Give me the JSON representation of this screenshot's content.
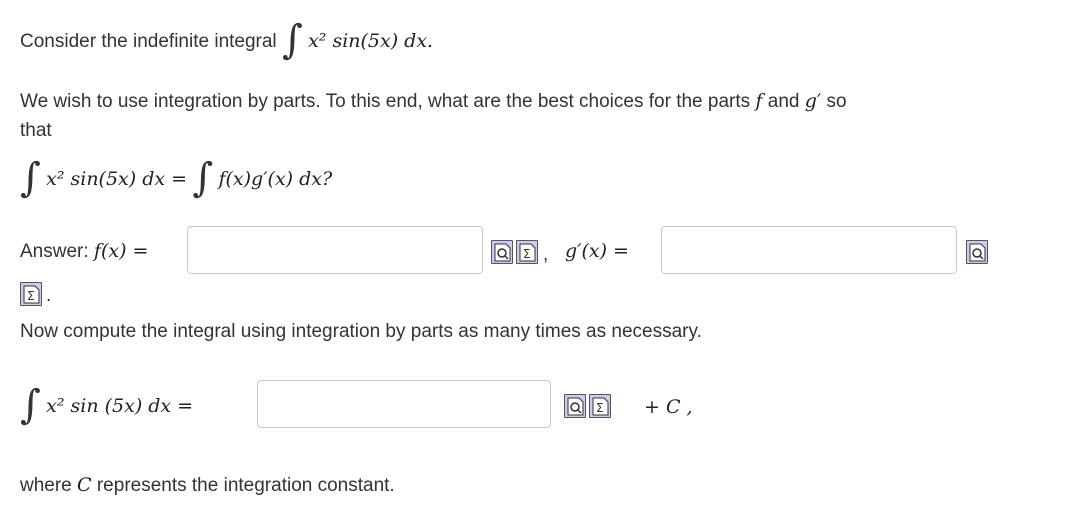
{
  "intro": {
    "text": "Consider the indefinite integral",
    "integrand": "x² sin(5x) dx."
  },
  "question": {
    "line1": "We wish to use integration by parts. To this end, what are the best choices for the parts",
    "f_symbol": "f",
    "and_word": "and",
    "g_symbol": "g′",
    "so_word": "so",
    "line2": "that"
  },
  "equation": {
    "left": "x² sin(5x) dx =",
    "right": "f(x)g′(x) dx?"
  },
  "answer_row": {
    "label": "Answer:",
    "f_expr": "f(x) =",
    "f_value": "",
    "comma": ",",
    "g_expr": "g′(x) =",
    "g_value": "",
    "period": "."
  },
  "compute": {
    "text": "Now compute the integral using integration by parts as many times as necessary.",
    "left": "x² sin (5x) dx =",
    "value": "",
    "constant": "+ C ,"
  },
  "footer": {
    "text_before": "where",
    "symbol": "C",
    "text_after": "represents the integration constant."
  },
  "icons": {
    "preview": "magnifier-preview-icon",
    "equation_editor": "sigma-equation-editor-icon",
    "color": "#c9cbef"
  }
}
